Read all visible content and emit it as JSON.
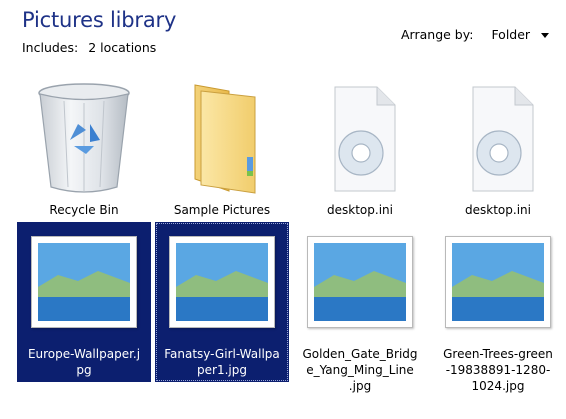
{
  "header": {
    "title": "Pictures library",
    "includes_label": "Includes:",
    "includes_link": "2 locations",
    "arrange_label": "Arrange by:",
    "arrange_value": "Folder"
  },
  "items": [
    {
      "label": "Recycle Bin",
      "icon": "recycle-bin-icon",
      "selected": false
    },
    {
      "label": "Sample Pictures",
      "icon": "folder-icon",
      "selected": false
    },
    {
      "label": "desktop.ini",
      "icon": "config-file-icon",
      "selected": false
    },
    {
      "label": "desktop.ini",
      "icon": "config-file-icon",
      "selected": false
    },
    {
      "label": "Europe-Wallpaper.jpg",
      "line1": "Europe-Wallpaper.j",
      "line2": "pg",
      "icon": "image-thumbnail",
      "selected": true
    },
    {
      "label": "Fanatsy-Girl-Wallpaper1.jpg",
      "line1": "Fanatsy-Girl-Wallpa",
      "line2": "per1.jpg",
      "icon": "image-thumbnail",
      "selected": true,
      "focused": true
    },
    {
      "label": "Golden_Gate_Bridge_Yang_Ming_Line.jpg",
      "line1": "Golden_Gate_Bridg",
      "line2": "e_Yang_Ming_Line",
      "line3": ".jpg",
      "icon": "image-thumbnail",
      "selected": false
    },
    {
      "label": "Green-Trees-green-19838891-1280-1024.jpg",
      "line1": "Green-Trees-green",
      "line2": "-19838891-1280-",
      "line3": "1024.jpg",
      "icon": "image-thumbnail",
      "selected": false
    }
  ],
  "colors": {
    "title": "#1e3287",
    "selection": "#0c1f6f"
  }
}
